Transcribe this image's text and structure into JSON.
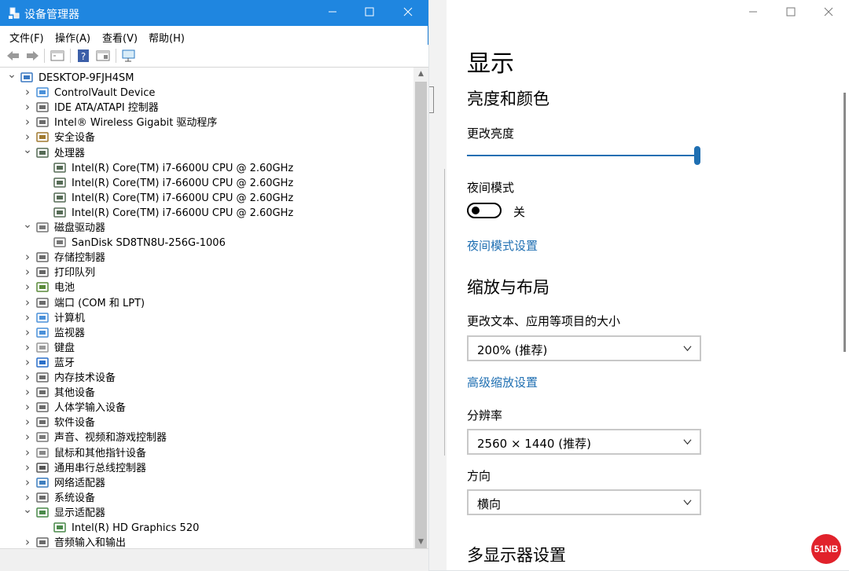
{
  "device_manager": {
    "title": "设备管理器",
    "menu": [
      "文件(F)",
      "操作(A)",
      "查看(V)",
      "帮助(H)"
    ],
    "tree": [
      {
        "label": "DESKTOP-9FJH4SM",
        "level": 0,
        "expanded": true,
        "icon": "computer-icon"
      },
      {
        "label": "ControlVault Device",
        "level": 1,
        "icon": "monitor-icon"
      },
      {
        "label": "IDE ATA/ATAPI 控制器",
        "level": 1,
        "icon": "ide-controller-icon"
      },
      {
        "label": "Intel® Wireless Gigabit 驱动程序",
        "level": 1,
        "icon": "driver-icon"
      },
      {
        "label": "安全设备",
        "level": 1,
        "icon": "security-key-icon"
      },
      {
        "label": "处理器",
        "level": 1,
        "expanded": true,
        "icon": "cpu-icon"
      },
      {
        "label": "Intel(R) Core(TM) i7-6600U CPU @ 2.60GHz",
        "level": 2,
        "icon": "cpu-icon"
      },
      {
        "label": "Intel(R) Core(TM) i7-6600U CPU @ 2.60GHz",
        "level": 2,
        "icon": "cpu-icon"
      },
      {
        "label": "Intel(R) Core(TM) i7-6600U CPU @ 2.60GHz",
        "level": 2,
        "icon": "cpu-icon"
      },
      {
        "label": "Intel(R) Core(TM) i7-6600U CPU @ 2.60GHz",
        "level": 2,
        "icon": "cpu-icon"
      },
      {
        "label": "磁盘驱动器",
        "level": 1,
        "expanded": true,
        "icon": "disk-icon"
      },
      {
        "label": "SanDisk SD8TN8U-256G-1006",
        "level": 2,
        "icon": "disk-icon"
      },
      {
        "label": "存储控制器",
        "level": 1,
        "icon": "storage-controller-icon"
      },
      {
        "label": "打印队列",
        "level": 1,
        "icon": "printer-icon"
      },
      {
        "label": "电池",
        "level": 1,
        "icon": "battery-icon"
      },
      {
        "label": "端口 (COM 和 LPT)",
        "level": 1,
        "icon": "port-icon"
      },
      {
        "label": "计算机",
        "level": 1,
        "icon": "monitor-icon"
      },
      {
        "label": "监视器",
        "level": 1,
        "icon": "monitor-icon"
      },
      {
        "label": "键盘",
        "level": 1,
        "icon": "keyboard-icon"
      },
      {
        "label": "蓝牙",
        "level": 1,
        "icon": "bluetooth-icon"
      },
      {
        "label": "内存技术设备",
        "level": 1,
        "icon": "memory-icon"
      },
      {
        "label": "其他设备",
        "level": 1,
        "icon": "unknown-device-icon"
      },
      {
        "label": "人体学输入设备",
        "level": 1,
        "icon": "hid-icon"
      },
      {
        "label": "软件设备",
        "level": 1,
        "icon": "software-device-icon"
      },
      {
        "label": "声音、视频和游戏控制器",
        "level": 1,
        "icon": "speaker-icon"
      },
      {
        "label": "鼠标和其他指针设备",
        "level": 1,
        "icon": "mouse-icon"
      },
      {
        "label": "通用串行总线控制器",
        "level": 1,
        "icon": "usb-icon"
      },
      {
        "label": "网络适配器",
        "level": 1,
        "icon": "network-icon"
      },
      {
        "label": "系统设备",
        "level": 1,
        "icon": "system-device-icon"
      },
      {
        "label": "显示适配器",
        "level": 1,
        "expanded": true,
        "icon": "display-adapter-icon"
      },
      {
        "label": "Intel(R) HD Graphics 520",
        "level": 2,
        "icon": "display-adapter-icon"
      },
      {
        "label": "音频输入和输出",
        "level": 1,
        "icon": "audio-io-icon"
      }
    ]
  },
  "settings": {
    "page_title": "显示",
    "section_brightness": "亮度和颜色",
    "brightness_label": "更改亮度",
    "brightness_level": 1.0,
    "night_mode_label": "夜间模式",
    "night_mode_state": "关",
    "night_mode_settings_link": "夜间模式设置",
    "section_scale": "缩放与布局",
    "scale_label": "更改文本、应用等项目的大小",
    "scale_value": "200% (推荐)",
    "advanced_scale_link": "高级缩放设置",
    "resolution_label": "分辨率",
    "resolution_value": "2560 × 1440 (推荐)",
    "orientation_label": "方向",
    "orientation_value": "横向",
    "section_multi_display": "多显示器设置"
  },
  "watermark": "51NB",
  "colors": {
    "titlebar": "#1f86e0",
    "accent": "#1f6fb2"
  }
}
